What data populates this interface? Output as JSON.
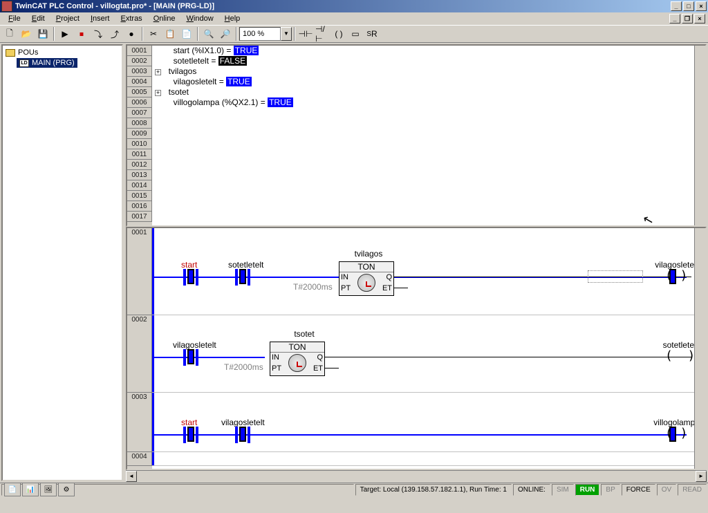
{
  "title": "TwinCAT PLC Control - villogtat.pro* - [MAIN (PRG-LD)]",
  "menu": {
    "file": "File",
    "edit": "Edit",
    "project": "Project",
    "insert": "Insert",
    "extras": "Extras",
    "online": "Online",
    "window": "Window",
    "help": "Help"
  },
  "zoom": "100 %",
  "tree": {
    "root": "POUs",
    "item": "MAIN (PRG)"
  },
  "vars": {
    "l1": {
      "pre": "        start (%IX1.0) = ",
      "val": "TRUE",
      "cls": "val-true"
    },
    "l2": {
      "pre": "        sotetletelt = ",
      "val": "FALSE",
      "cls": "val-false"
    },
    "l3": {
      "pre": "  tvilagos"
    },
    "l4": {
      "pre": "        vilagosletelt = ",
      "val": "TRUE",
      "cls": "val-true"
    },
    "l5": {
      "pre": "  tsotet"
    },
    "l6": {
      "pre": "        villogolampa (%QX2.1) = ",
      "val": "TRUE",
      "cls": "val-true"
    }
  },
  "lineNums": [
    "0001",
    "0002",
    "0003",
    "0004",
    "0005",
    "0006",
    "0007",
    "0008",
    "0009",
    "0010",
    "0011",
    "0012",
    "0013",
    "0014",
    "0015",
    "0016",
    "0017"
  ],
  "rungs": {
    "r1": "0001",
    "r2": "0002",
    "r3": "0003",
    "r4": "0004"
  },
  "labels": {
    "start": "start",
    "sotetletelt": "sotetletelt",
    "tvilagos": "tvilagos",
    "ton": "TON",
    "in": "IN",
    "q": "Q",
    "pt": "PT",
    "et": "ET",
    "t2000": "T#2000ms",
    "vilagosletelt": "vilagosletelt",
    "tsotet": "tsotet",
    "villogolampa": "villogolampa"
  },
  "status": {
    "target": "Target: Local (139.158.57.182.1.1), Run Time: 1",
    "online": "ONLINE:",
    "sim": "SIM",
    "run": "RUN",
    "bp": "BP",
    "force": "FORCE",
    "ov": "OV",
    "read": "READ"
  }
}
